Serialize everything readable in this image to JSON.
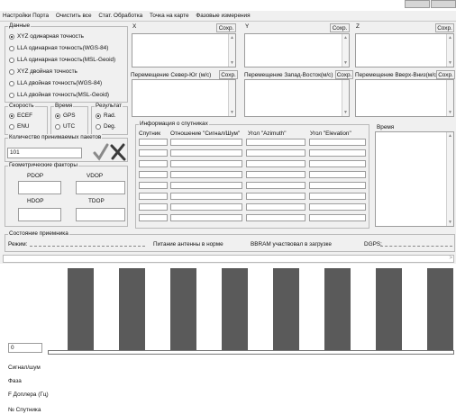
{
  "menu": [
    "Настройки Порта",
    "Очистить все",
    "Стат. Обработка",
    "Точка на карте",
    "Фазовые измерения"
  ],
  "data_group": {
    "title": "Данные",
    "options": [
      {
        "label": "XYZ одинарная точность",
        "selected": true
      },
      {
        "label": "LLA одинарная точность(WGS-84)",
        "selected": false
      },
      {
        "label": "LLA одинарная точность(MSL-Geoid)",
        "selected": false
      },
      {
        "label": "XYZ двойная точность",
        "selected": false
      },
      {
        "label": "LLA двойная точность(WGS-84)",
        "selected": false
      },
      {
        "label": "LLA двойная точность(MSL-Geoid)",
        "selected": false
      }
    ]
  },
  "speed_group": {
    "title": "Скорость",
    "options": [
      {
        "label": "ECEF",
        "selected": true
      },
      {
        "label": "ENU",
        "selected": false
      }
    ]
  },
  "time_group": {
    "title": "Время",
    "options": [
      {
        "label": "GPS",
        "selected": true
      },
      {
        "label": "UTC",
        "selected": false
      }
    ]
  },
  "result_group": {
    "title": "Результат",
    "options": [
      {
        "label": "Rad.",
        "selected": true
      },
      {
        "label": "Deg.",
        "selected": false
      }
    ]
  },
  "packets": {
    "title": "Количество принимаемых пакетов",
    "value": "101"
  },
  "geometry": {
    "title": "Геометрические факторы",
    "pdop": "PDOP",
    "vdop": "VDOP",
    "hdop": "HDOP",
    "tdop": "TDOP"
  },
  "coords": {
    "x_label": "X",
    "y_label": "Y",
    "z_label": "Z",
    "save": "Сохр.",
    "move_north": "Перемещение  Север-Юг (м/с)",
    "move_east": "Перемещение Запад-Восток(м/с)",
    "move_up": "Перемещение Вверх-Вниз(м/с)"
  },
  "satellites": {
    "title": "Информация о спутниках",
    "columns": [
      "Спутник",
      "Отношение \"Сигнал/Шум\"",
      "Угол \"Azimuth\"",
      "Угол \"Elevation\""
    ]
  },
  "time_panel": {
    "title": "Время"
  },
  "receiver": {
    "title": "Состояние приемника",
    "mode": "Режим:",
    "antenna": "Питание антенны в норме",
    "bbram": "BBRAM участвовал в загрузке",
    "dgps": "DGPS:"
  },
  "bottom": {
    "input_value": "0",
    "signal": "Сигнал/шум",
    "phase": "Фаза",
    "doppler": "F Доплера (Гц)",
    "sat_no": "№ Спутника"
  },
  "chart_data": {
    "type": "bar",
    "categories": [
      "",
      "",
      "",
      "",
      "",
      "",
      "",
      ""
    ],
    "values": [
      1,
      1,
      1,
      1,
      1,
      1,
      1,
      1
    ],
    "title": "",
    "xlabel": "",
    "ylabel": ""
  }
}
